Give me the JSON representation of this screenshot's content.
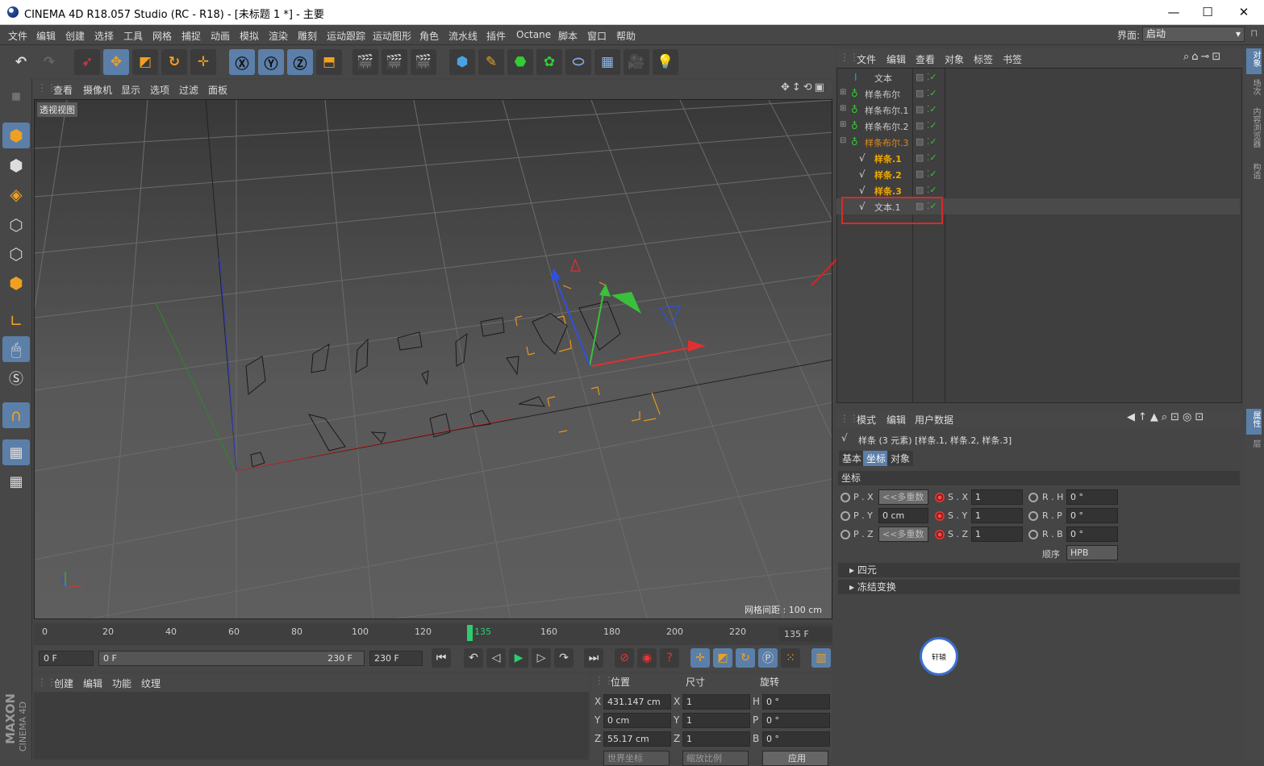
{
  "window": {
    "title": "CINEMA 4D R18.057 Studio (RC - R18) - [未标题 1 *] - 主要",
    "minimize": "—",
    "maximize": "☐",
    "close": "✕"
  },
  "menu": {
    "items": [
      "文件",
      "编辑",
      "创建",
      "选择",
      "工具",
      "网格",
      "捕捉",
      "动画",
      "模拟",
      "渲染",
      "雕刻",
      "运动跟踪",
      "运动图形",
      "角色",
      "流水线",
      "插件",
      "Octane",
      "脚本",
      "窗口",
      "帮助"
    ],
    "interface_label": "界面:",
    "interface_value": "启动"
  },
  "viewport": {
    "menu": [
      "查看",
      "摄像机",
      "显示",
      "选项",
      "过滤",
      "面板"
    ],
    "label": "透视视图",
    "grid_label": "网格间距 : 100 cm"
  },
  "timeline": {
    "ticks": [
      "0",
      "20",
      "40",
      "60",
      "80",
      "100",
      "120",
      "160",
      "180",
      "200",
      "220"
    ],
    "current": "135",
    "frame_box": "135 F"
  },
  "playbar": {
    "start": "0 F",
    "range_start": "0 F",
    "range_end": "230 F",
    "end": "230 F"
  },
  "materials": {
    "menu": [
      "创建",
      "编辑",
      "功能",
      "纹理"
    ]
  },
  "coords": {
    "headers": [
      "位置",
      "尺寸",
      "旋转"
    ],
    "rows": [
      {
        "a": "X",
        "pos": "431.147 cm",
        "b": "X",
        "size": "1",
        "c": "H",
        "rot": "0 °"
      },
      {
        "a": "Y",
        "pos": "0 cm",
        "b": "Y",
        "size": "1",
        "c": "P",
        "rot": "0 °"
      },
      {
        "a": "Z",
        "pos": "55.17 cm",
        "b": "Z",
        "size": "1",
        "c": "B",
        "rot": "0 °"
      }
    ],
    "btn_mode": "世界坐标",
    "btn_scale": "缩放比例",
    "apply": "应用"
  },
  "objects": {
    "menu": [
      "文件",
      "编辑",
      "查看",
      "对象",
      "标签",
      "书签"
    ],
    "rows": [
      {
        "name": "文本",
        "color": "#cccccc"
      },
      {
        "name": "样条布尔",
        "color": "#cccccc"
      },
      {
        "name": "样条布尔.1",
        "color": "#cccccc"
      },
      {
        "name": "样条布尔.2",
        "color": "#cccccc"
      },
      {
        "name": "样条布尔.3",
        "color": "#e08a1e"
      },
      {
        "name": "样条.1",
        "color": "#f2a800"
      },
      {
        "name": "样条.2",
        "color": "#f2a800"
      },
      {
        "name": "样条.3",
        "color": "#f2a800"
      },
      {
        "name": "文本.1",
        "color": "#cccccc"
      }
    ]
  },
  "attributes": {
    "menu": [
      "模式",
      "编辑",
      "用户数据"
    ],
    "title": "样条 (3 元素) [样条.1, 样条.2, 样条.3]",
    "tabs": [
      "基本",
      "坐标",
      "对象"
    ],
    "section": "坐标",
    "p": [
      {
        "l": "P . X",
        "v": "<<多重数"
      },
      {
        "l": "P . Y",
        "v": "0 cm"
      },
      {
        "l": "P . Z",
        "v": "<<多重数"
      }
    ],
    "s": [
      {
        "l": "S . X",
        "v": "1"
      },
      {
        "l": "S . Y",
        "v": "1"
      },
      {
        "l": "S . Z",
        "v": "1"
      }
    ],
    "r": [
      {
        "l": "R . H",
        "v": "0 °"
      },
      {
        "l": "R . P",
        "v": "0 °"
      },
      {
        "l": "R . B",
        "v": "0 °"
      }
    ],
    "order_label": "顺序",
    "order_value": "HPB",
    "quat": "四元",
    "freeze": "冻结变换"
  },
  "right_tabs": [
    "对象",
    "场次",
    "内容浏览器",
    "构造"
  ],
  "right_tabs2": [
    "属性",
    "层"
  ],
  "brand": {
    "maxon": "MAXON",
    "c4d": "CINEMA 4D"
  },
  "watermark": "轩辕"
}
